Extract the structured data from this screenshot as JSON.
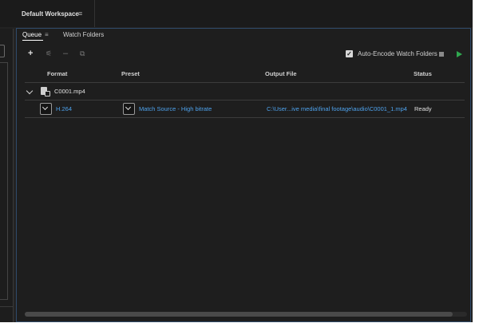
{
  "workspace": {
    "title": "Default Workspace",
    "menu_icon": "hamburger-icon"
  },
  "tabs": [
    {
      "label": "Queue",
      "active": true
    },
    {
      "label": "Watch Folders",
      "active": false
    }
  ],
  "toolbar": {
    "add_icon": "plus-icon",
    "settings_icon": "preset-settings-icon",
    "remove_icon": "minus-icon",
    "duplicate_icon": "duplicate-icon",
    "auto_encode_label": "Auto-Encode Watch Folders",
    "auto_encode_checked": true,
    "stop_icon": "stop-icon",
    "start_icon": "play-icon"
  },
  "columns": {
    "format": "Format",
    "preset": "Preset",
    "output": "Output File",
    "status": "Status"
  },
  "queue": [
    {
      "file": "C0001.mp4",
      "items": [
        {
          "format": "H.264",
          "preset": "Match Source - High bitrate",
          "output": "C:\\User...ive media\\final footage\\audio\\C0001_1.mp4",
          "status": "Ready"
        }
      ]
    }
  ],
  "colors": {
    "link": "#4ea2ec",
    "play": "#2fa84f",
    "panel_bg": "#1e1e1e"
  }
}
